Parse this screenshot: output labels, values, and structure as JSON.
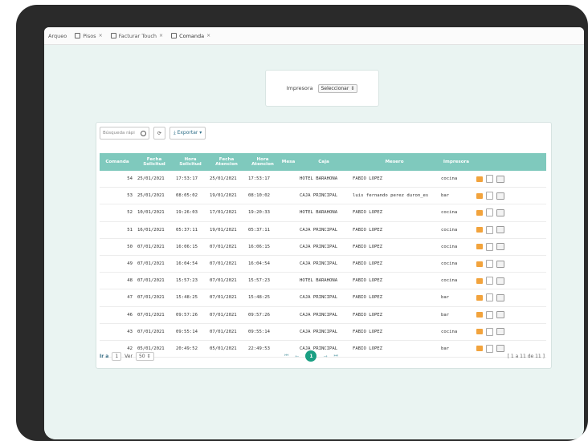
{
  "tabs": [
    {
      "label": "Arqueo",
      "close": "",
      "icon": false
    },
    {
      "label": "Pisos",
      "close": "×",
      "icon": true
    },
    {
      "label": "Facturar Touch",
      "close": "×",
      "icon": true
    },
    {
      "label": "Comanda",
      "close": "×",
      "icon": true
    }
  ],
  "printer": {
    "label": "Impresora",
    "select_value": "Seleccionar",
    "select_arrow": "⇕"
  },
  "toolbar": {
    "search_placeholder": "Búsqueda rápi",
    "search_glyph": "⌕",
    "refresh_glyph": "⟳",
    "export_label": "⤓ Exportar ▾"
  },
  "table": {
    "headers": [
      "Comanda",
      "Fecha Solicitud",
      "Hora Solicitud",
      "Fecha Atencion",
      "Hora Atencion",
      "Mesa",
      "Caja",
      "Mesero",
      "Impresora",
      ""
    ],
    "rows": [
      [
        "54",
        "25/01/2021",
        "17:53:17",
        "25/01/2021",
        "17:53:17",
        "",
        "HOTEL BARAHONA",
        "FABIO LOPEZ",
        "cocina"
      ],
      [
        "53",
        "25/01/2021",
        "08:05:02",
        "19/01/2021",
        "08:10:02",
        "",
        "CAJA PRINCIPAL",
        "luis fernando perez duron_es",
        "bar"
      ],
      [
        "52",
        "10/01/2021",
        "19:26:03",
        "17/01/2021",
        "19:20:33",
        "",
        "HOTEL BARAHONA",
        "FABIO LOPEZ",
        "cocina"
      ],
      [
        "51",
        "16/01/2021",
        "05:37:11",
        "19/01/2021",
        "05:37:11",
        "",
        "CAJA PRINCIPAL",
        "FABIO LOPEZ",
        "cocina"
      ],
      [
        "50",
        "07/01/2021",
        "16:06:15",
        "07/01/2021",
        "16:06:15",
        "",
        "CAJA PRINCIPAL",
        "FABIO LOPEZ",
        "cocina"
      ],
      [
        "49",
        "07/01/2021",
        "16:04:54",
        "07/01/2021",
        "16:04:54",
        "",
        "CAJA PRINCIPAL",
        "FABIO LOPEZ",
        "cocina"
      ],
      [
        "48",
        "07/01/2021",
        "15:57:23",
        "07/01/2021",
        "15:57:23",
        "",
        "HOTEL BARAHONA",
        "FABIO LOPEZ",
        "cocina"
      ],
      [
        "47",
        "07/01/2021",
        "15:48:25",
        "07/01/2021",
        "15:48:25",
        "",
        "CAJA PRINCIPAL",
        "FABIO LOPEZ",
        "bar"
      ],
      [
        "46",
        "07/01/2021",
        "09:57:26",
        "07/01/2021",
        "09:57:26",
        "",
        "CAJA PRINCIPAL",
        "FABIO LOPEZ",
        "bar"
      ],
      [
        "43",
        "07/01/2021",
        "09:55:14",
        "07/01/2021",
        "09:55:14",
        "",
        "CAJA PRINCIPAL",
        "FABIO LOPEZ",
        "cocina"
      ],
      [
        "42",
        "05/01/2021",
        "20:49:52",
        "05/01/2021",
        "22:49:53",
        "",
        "CAJA PRINCIPAL",
        "FABIO LOPEZ",
        "bar"
      ]
    ]
  },
  "pager": {
    "goto_label": "Ir a",
    "goto_value": "1",
    "per_page_label": "Ver",
    "per_page_value": "50 ⇕",
    "first": "⏮",
    "prev": "←",
    "current": "1",
    "next": "→",
    "last": "⏭",
    "range": "[ 1 a 11 de 11 ]"
  },
  "colors": {
    "header": "#7fc9bd",
    "accent": "#1a9f83",
    "edit_icon": "#f2a33c"
  }
}
